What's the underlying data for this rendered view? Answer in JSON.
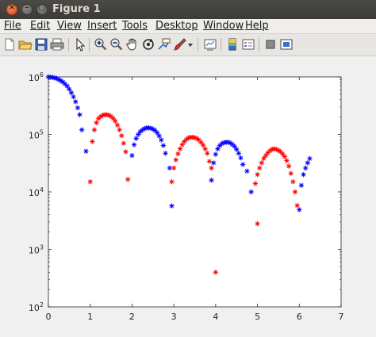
{
  "window": {
    "title": "Figure 1",
    "close_symbol": "×",
    "minimize_symbol": "–",
    "maximize_symbol": "□"
  },
  "menu": [
    "File",
    "Edit",
    "View",
    "Insert",
    "Tools",
    "Desktop",
    "Window",
    "Help"
  ],
  "toolbar_icons": [
    "new-figure-icon",
    "open-file-icon",
    "save-icon",
    "print-icon",
    "edit-plot-arrow-icon",
    "zoom-in-icon",
    "zoom-out-icon",
    "pan-hand-icon",
    "rotate-3d-icon",
    "data-cursor-icon",
    "brush-icon",
    "brush-dropdown-icon",
    "link-plot-icon",
    "insert-colorbar-icon",
    "insert-legend-icon",
    "hide-plot-tools-icon",
    "show-plot-tools-icon"
  ],
  "colors": {
    "series_blue": "#0000ff",
    "series_red": "#ff0000",
    "titlebar": "#3c3b37",
    "figure_background": "#f0f0f0",
    "axes_background": "#ffffff"
  },
  "chart_data": {
    "type": "scatter",
    "marker": "*",
    "y_scale": "log",
    "xlim": [
      0,
      7
    ],
    "ylim": [
      100,
      1000000
    ],
    "grid": false,
    "x_ticks": [
      0,
      1,
      2,
      3,
      4,
      5,
      6,
      7
    ],
    "x_tick_labels": [
      "0",
      "1",
      "2",
      "3",
      "4",
      "5",
      "6",
      "7"
    ],
    "y_ticks": [
      100,
      1000,
      10000,
      100000,
      1000000
    ],
    "y_tick_labels": [
      {
        "base": "10",
        "exp": "2"
      },
      {
        "base": "10",
        "exp": "3"
      },
      {
        "base": "10",
        "exp": "4"
      },
      {
        "base": "10",
        "exp": "5"
      },
      {
        "base": "10",
        "exp": "6"
      }
    ],
    "series": [
      {
        "color": "#0000ff",
        "points": [
          [
            0.0,
            1000000
          ],
          [
            0.05,
            990000
          ],
          [
            0.1,
            980000
          ],
          [
            0.15,
            960000
          ],
          [
            0.2,
            940000
          ],
          [
            0.25,
            900000
          ],
          [
            0.3,
            860000
          ],
          [
            0.35,
            810000
          ],
          [
            0.4,
            750000
          ],
          [
            0.45,
            690000
          ],
          [
            0.5,
            610000
          ],
          [
            0.55,
            530000
          ],
          [
            0.6,
            450000
          ],
          [
            0.65,
            370000
          ],
          [
            0.7,
            290000
          ],
          [
            0.75,
            220000
          ],
          [
            0.8,
            120000
          ],
          [
            0.9,
            51000
          ],
          [
            2.0,
            43000
          ],
          [
            2.05,
            66000
          ],
          [
            2.1,
            85000
          ],
          [
            2.15,
            100000
          ],
          [
            2.2,
            112000
          ],
          [
            2.25,
            120000
          ],
          [
            2.3,
            126000
          ],
          [
            2.35,
            130000
          ],
          [
            2.4,
            130000
          ],
          [
            2.45,
            128000
          ],
          [
            2.5,
            124000
          ],
          [
            2.55,
            117000
          ],
          [
            2.6,
            107000
          ],
          [
            2.65,
            94000
          ],
          [
            2.7,
            80000
          ],
          [
            2.75,
            64000
          ],
          [
            2.8,
            47000
          ],
          [
            2.9,
            26000
          ],
          [
            2.95,
            5700
          ],
          [
            3.9,
            16000
          ],
          [
            3.95,
            32000
          ],
          [
            4.0,
            45000
          ],
          [
            4.05,
            56000
          ],
          [
            4.1,
            64000
          ],
          [
            4.15,
            69000
          ],
          [
            4.2,
            72000
          ],
          [
            4.25,
            73000
          ],
          [
            4.3,
            73000
          ],
          [
            4.35,
            71000
          ],
          [
            4.4,
            67000
          ],
          [
            4.45,
            62000
          ],
          [
            4.5,
            55000
          ],
          [
            4.55,
            47000
          ],
          [
            4.6,
            39000
          ],
          [
            4.65,
            30000
          ],
          [
            4.75,
            23000
          ],
          [
            4.85,
            10000
          ],
          [
            6.0,
            4900
          ],
          [
            6.05,
            13000
          ],
          [
            6.1,
            20000
          ],
          [
            6.15,
            26000
          ],
          [
            6.2,
            32000
          ],
          [
            6.25,
            38000
          ]
        ]
      },
      {
        "color": "#ff0000",
        "points": [
          [
            1.0,
            15000
          ],
          [
            1.05,
            75000
          ],
          [
            1.1,
            120000
          ],
          [
            1.15,
            160000
          ],
          [
            1.2,
            190000
          ],
          [
            1.25,
            205000
          ],
          [
            1.3,
            215000
          ],
          [
            1.35,
            220000
          ],
          [
            1.4,
            220000
          ],
          [
            1.45,
            215000
          ],
          [
            1.5,
            205000
          ],
          [
            1.55,
            190000
          ],
          [
            1.6,
            170000
          ],
          [
            1.65,
            145000
          ],
          [
            1.7,
            120000
          ],
          [
            1.75,
            95000
          ],
          [
            1.8,
            70000
          ],
          [
            1.85,
            50000
          ],
          [
            1.9,
            16500
          ],
          [
            2.95,
            15000
          ],
          [
            3.0,
            26000
          ],
          [
            3.05,
            36000
          ],
          [
            3.1,
            46000
          ],
          [
            3.15,
            56000
          ],
          [
            3.2,
            66000
          ],
          [
            3.25,
            75000
          ],
          [
            3.3,
            82000
          ],
          [
            3.35,
            87000
          ],
          [
            3.4,
            89000
          ],
          [
            3.45,
            89000
          ],
          [
            3.5,
            88000
          ],
          [
            3.55,
            85000
          ],
          [
            3.6,
            80000
          ],
          [
            3.65,
            73000
          ],
          [
            3.7,
            65000
          ],
          [
            3.75,
            56000
          ],
          [
            3.8,
            47000
          ],
          [
            3.85,
            34000
          ],
          [
            3.9,
            26000
          ],
          [
            4.0,
            400
          ],
          [
            4.95,
            14000
          ],
          [
            5.0,
            20000
          ],
          [
            5.05,
            26000
          ],
          [
            5.1,
            32000
          ],
          [
            5.15,
            38000
          ],
          [
            5.2,
            43000
          ],
          [
            5.25,
            48000
          ],
          [
            5.3,
            52000
          ],
          [
            5.35,
            55000
          ],
          [
            5.4,
            56000
          ],
          [
            5.45,
            55000
          ],
          [
            5.5,
            53000
          ],
          [
            5.55,
            50000
          ],
          [
            5.6,
            46000
          ],
          [
            5.65,
            41000
          ],
          [
            5.7,
            35000
          ],
          [
            5.75,
            28000
          ],
          [
            5.8,
            21000
          ],
          [
            5.85,
            15000
          ],
          [
            5.9,
            10000
          ],
          [
            5.95,
            5800
          ],
          [
            5.0,
            2800
          ]
        ]
      }
    ]
  }
}
